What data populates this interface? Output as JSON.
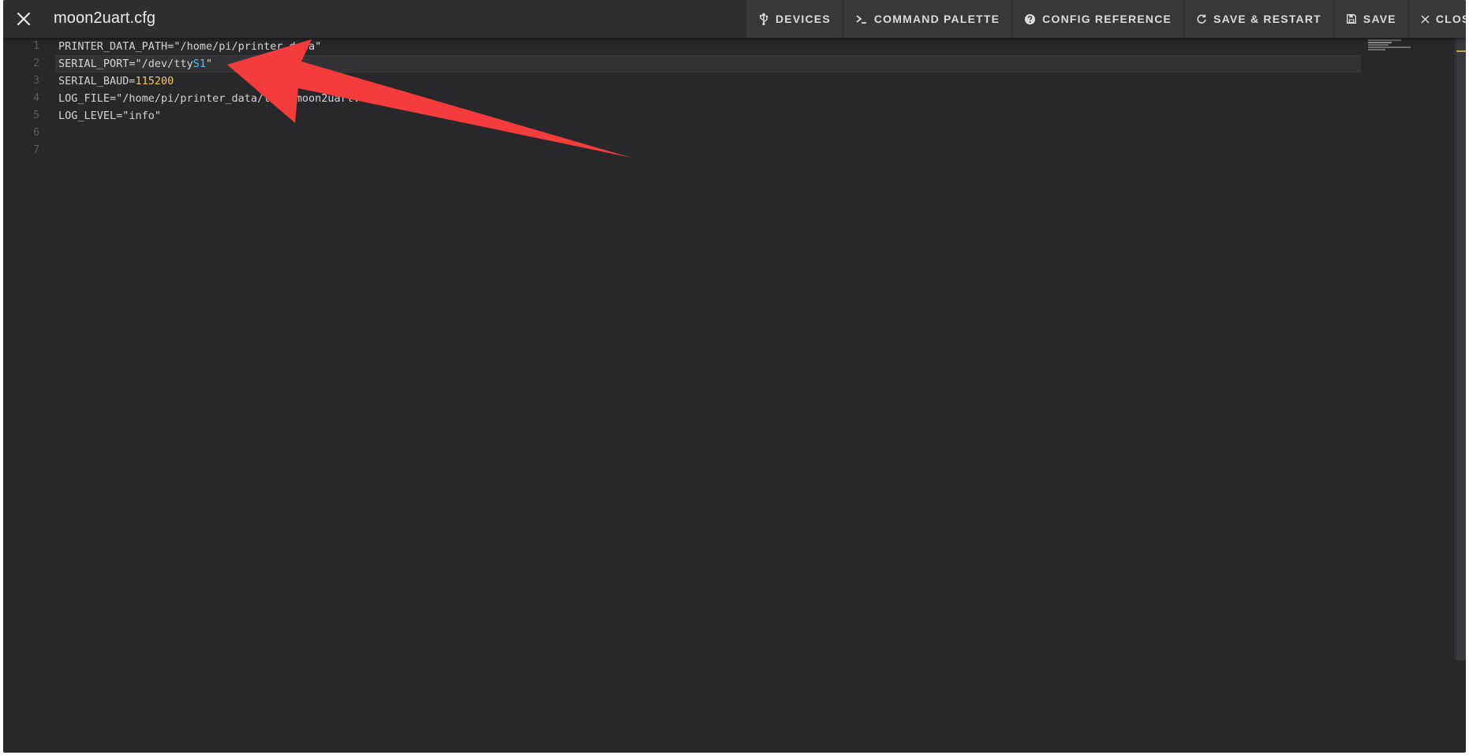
{
  "header": {
    "title": "moon2uart.cfg",
    "close_icon": "close-icon"
  },
  "toolbar": {
    "actions": [
      {
        "label": "Devices",
        "icon": "usb-icon"
      },
      {
        "label": "Command Palette",
        "icon": "console-prompt-icon"
      },
      {
        "label": "Config Reference",
        "icon": "help-circle-icon"
      },
      {
        "label": "Save & Restart",
        "icon": "restart-icon"
      },
      {
        "label": "Save",
        "icon": "floppy-disk-icon"
      },
      {
        "label": "Close",
        "icon": "close-icon"
      }
    ]
  },
  "editor": {
    "line_numbers": [
      "1",
      "2",
      "3",
      "4",
      "5",
      "6",
      "7"
    ],
    "lines": [
      {
        "key": "PRINTER_DATA_PATH=",
        "value": "\"/home/pi/printer_data\""
      },
      {
        "key": "SERIAL_PORT=",
        "value_a": "\"/dev/tty",
        "value_b": "S1",
        "value_c": "\""
      },
      {
        "key": "SERIAL_BAUD=",
        "value": "115200"
      },
      {
        "key": "LOG_FILE=",
        "value": "\"/home/pi/printer_data/logs/moon2uart.log\""
      },
      {
        "key": "LOG_LEVEL=",
        "value": "\"info\""
      },
      {
        "key": "",
        "value": ""
      },
      {
        "key": "",
        "value": ""
      }
    ]
  },
  "colors": {
    "background": "#28282b",
    "toolbar": "#2f2f32",
    "number_literal": "#f2c46a",
    "highlight_text": "#4fc3f7",
    "annotation_arrow": "#f53c3c"
  }
}
